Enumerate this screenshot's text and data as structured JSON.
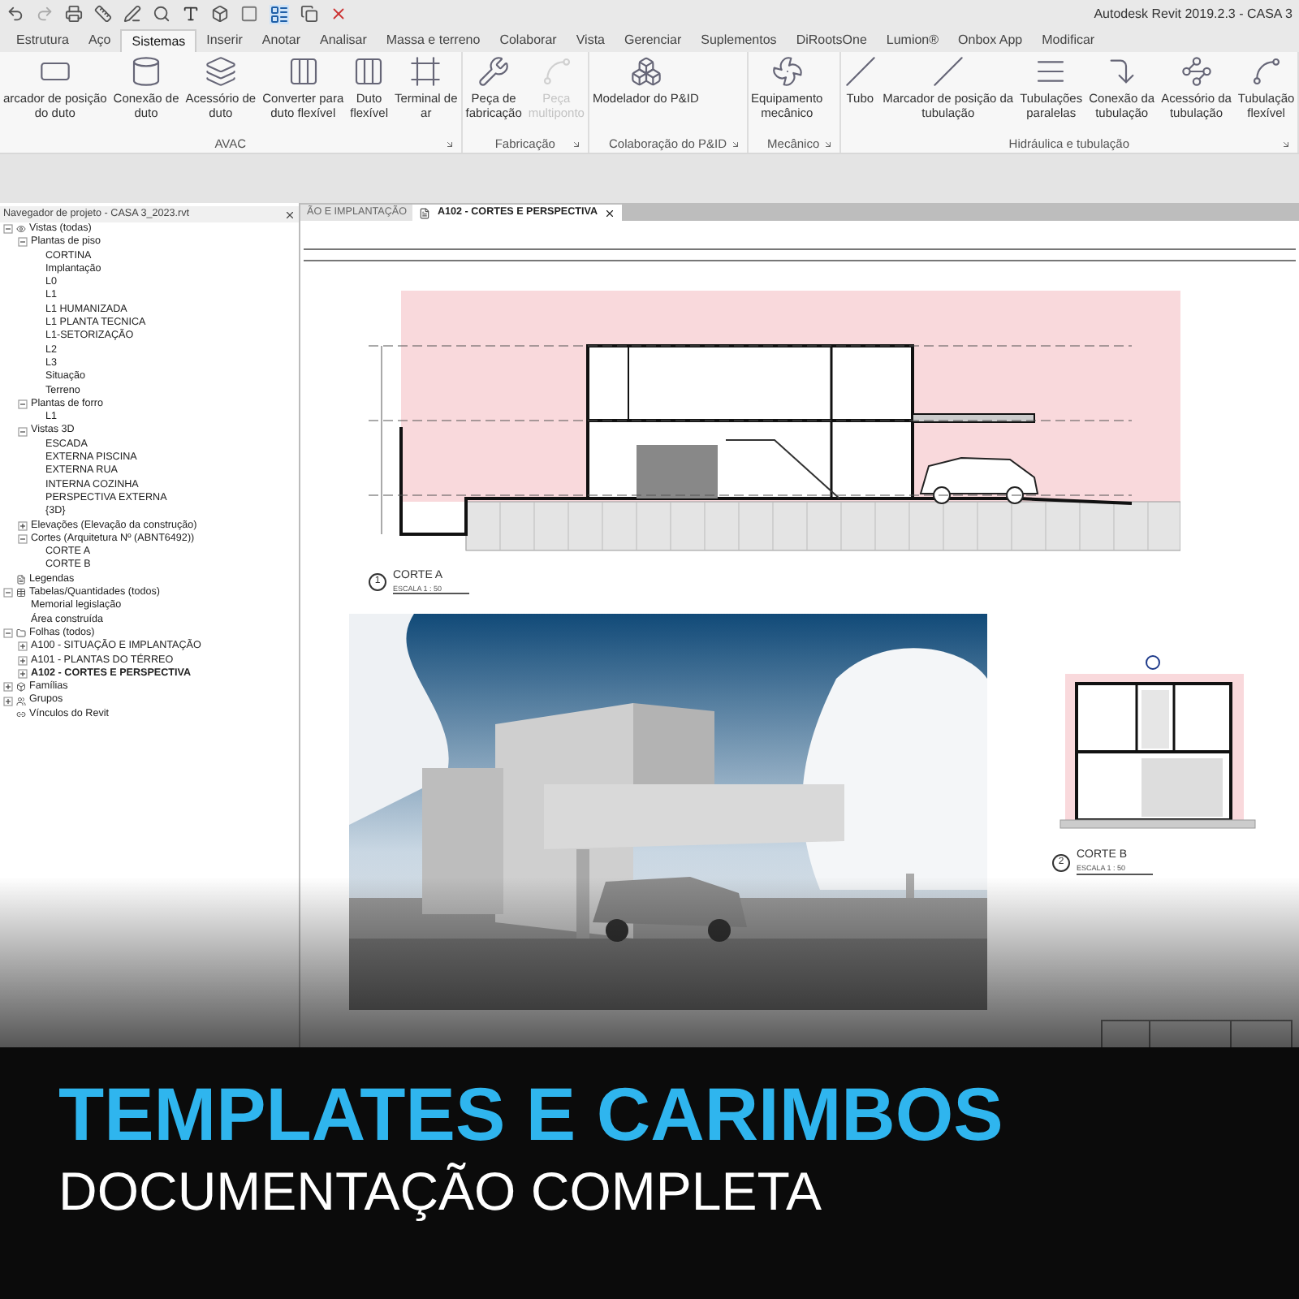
{
  "window": {
    "title": "Autodesk Revit 2019.2.3 - CASA 3"
  },
  "ribbon_tabs": [
    {
      "label": "Estrutura",
      "selected": false
    },
    {
      "label": "Aço",
      "selected": false
    },
    {
      "label": "Sistemas",
      "selected": true
    },
    {
      "label": "Inserir",
      "selected": false
    },
    {
      "label": "Anotar",
      "selected": false
    },
    {
      "label": "Analisar",
      "selected": false
    },
    {
      "label": "Massa e terreno",
      "selected": false
    },
    {
      "label": "Colaborar",
      "selected": false
    },
    {
      "label": "Vista",
      "selected": false
    },
    {
      "label": "Gerenciar",
      "selected": false
    },
    {
      "label": "Suplementos",
      "selected": false
    },
    {
      "label": "DiRootsOne",
      "selected": false
    },
    {
      "label": "Lumion®",
      "selected": false
    },
    {
      "label": "Onbox App",
      "selected": false
    },
    {
      "label": "Modificar",
      "selected": false
    }
  ],
  "ribbon_panels": [
    {
      "title": "AVAC",
      "buttons": [
        {
          "label": "arcador de posição\ndo duto",
          "disabled": false
        },
        {
          "label": "Conexão de\nduto",
          "disabled": false
        },
        {
          "label": "Acessório de\nduto",
          "disabled": false
        },
        {
          "label": "Converter para\nduto flexível",
          "disabled": false
        },
        {
          "label": "Duto\nflexível",
          "disabled": false
        },
        {
          "label": "Terminal de\nar",
          "disabled": false
        }
      ]
    },
    {
      "title": "Fabricação",
      "buttons": [
        {
          "label": "Peça de\nfabricação",
          "disabled": false
        },
        {
          "label": "Peça\nmultiponto",
          "disabled": true
        }
      ]
    },
    {
      "title": "Colaboração do P&ID",
      "buttons": [
        {
          "label": "Modelador do P&ID",
          "disabled": false
        }
      ]
    },
    {
      "title": "Mecânico",
      "buttons": [
        {
          "label": "Equipamento\nmecânico",
          "disabled": false
        }
      ]
    },
    {
      "title": "Hidráulica e tubulação",
      "buttons": [
        {
          "label": "Tubo",
          "disabled": false
        },
        {
          "label": "Marcador de posição da\ntubulação",
          "disabled": false
        },
        {
          "label": "Tubulações\nparalelas",
          "disabled": false
        },
        {
          "label": "Conexão da\ntubulação",
          "disabled": false
        },
        {
          "label": "Acessório da\ntubulação",
          "disabled": false
        },
        {
          "label": "Tubulação\nflexível",
          "disabled": false
        }
      ]
    }
  ],
  "project_browser": {
    "title": "Navegador de projeto - CASA 3_2023.rvt",
    "items": [
      {
        "label": "Vistas (todas)",
        "expanded": true,
        "children": [
          {
            "label": "Plantas de piso",
            "expanded": true,
            "children": [
              {
                "label": "CORTINA"
              },
              {
                "label": "Implantação"
              },
              {
                "label": "L0"
              },
              {
                "label": "L1"
              },
              {
                "label": "L1 HUMANIZADA"
              },
              {
                "label": "L1 PLANTA TECNICA"
              },
              {
                "label": "L1-SETORIZAÇÃO"
              },
              {
                "label": "L2"
              },
              {
                "label": "L3"
              },
              {
                "label": "Situação"
              },
              {
                "label": "Terreno"
              }
            ]
          },
          {
            "label": "Plantas de forro",
            "expanded": true,
            "children": [
              {
                "label": "L1"
              }
            ]
          },
          {
            "label": "Vistas 3D",
            "expanded": true,
            "children": [
              {
                "label": "ESCADA"
              },
              {
                "label": "EXTERNA PISCINA"
              },
              {
                "label": "EXTERNA RUA"
              },
              {
                "label": "INTERNA COZINHA"
              },
              {
                "label": "PERSPECTIVA EXTERNA"
              },
              {
                "label": "{3D}"
              }
            ]
          },
          {
            "label": "Elevações (Elevação da construção)",
            "expanded": false
          },
          {
            "label": "Cortes (Arquitetura Nº (ABNT6492))",
            "expanded": true,
            "children": [
              {
                "label": "CORTE A"
              },
              {
                "label": "CORTE B"
              }
            ]
          }
        ]
      },
      {
        "label": "Legendas"
      },
      {
        "label": "Tabelas/Quantidades (todos)",
        "expanded": true,
        "children": [
          {
            "label": "Memorial legislação"
          },
          {
            "label": "Área construída"
          }
        ]
      },
      {
        "label": "Folhas (todos)",
        "expanded": true,
        "children": [
          {
            "label": "A100 - SITUAÇÃO E IMPLANTAÇÃO",
            "expanded": false,
            "current": false
          },
          {
            "label": "A101 - PLANTAS DO TÉRREO",
            "expanded": false,
            "current": false
          },
          {
            "label": "A102 - CORTES E PERSPECTIVA",
            "expanded": false,
            "current": true
          }
        ]
      },
      {
        "label": "Famílias",
        "expanded": false
      },
      {
        "label": "Grupos",
        "expanded": false
      },
      {
        "label": "Vínculos do Revit"
      }
    ]
  },
  "view_tabs": [
    {
      "label": "ÃO E IMPLANTAÇÃO",
      "selected": false
    },
    {
      "label": "A102 - CORTES E PERSPECTIVA",
      "selected": true
    }
  ],
  "sheet": {
    "views": [
      {
        "kind": "section",
        "number": "1",
        "title": "CORTE A",
        "scale": "ESCALA 1 : 50"
      },
      {
        "kind": "picture"
      },
      {
        "kind": "section",
        "number": "2",
        "title": "CORTE B",
        "scale": "ESCALA 1 : 50"
      }
    ]
  },
  "banner": {
    "headline": "TEMPLATES E CARIMBOS",
    "subtitle": "DOCUMENTAÇÃO COMPLETA"
  }
}
